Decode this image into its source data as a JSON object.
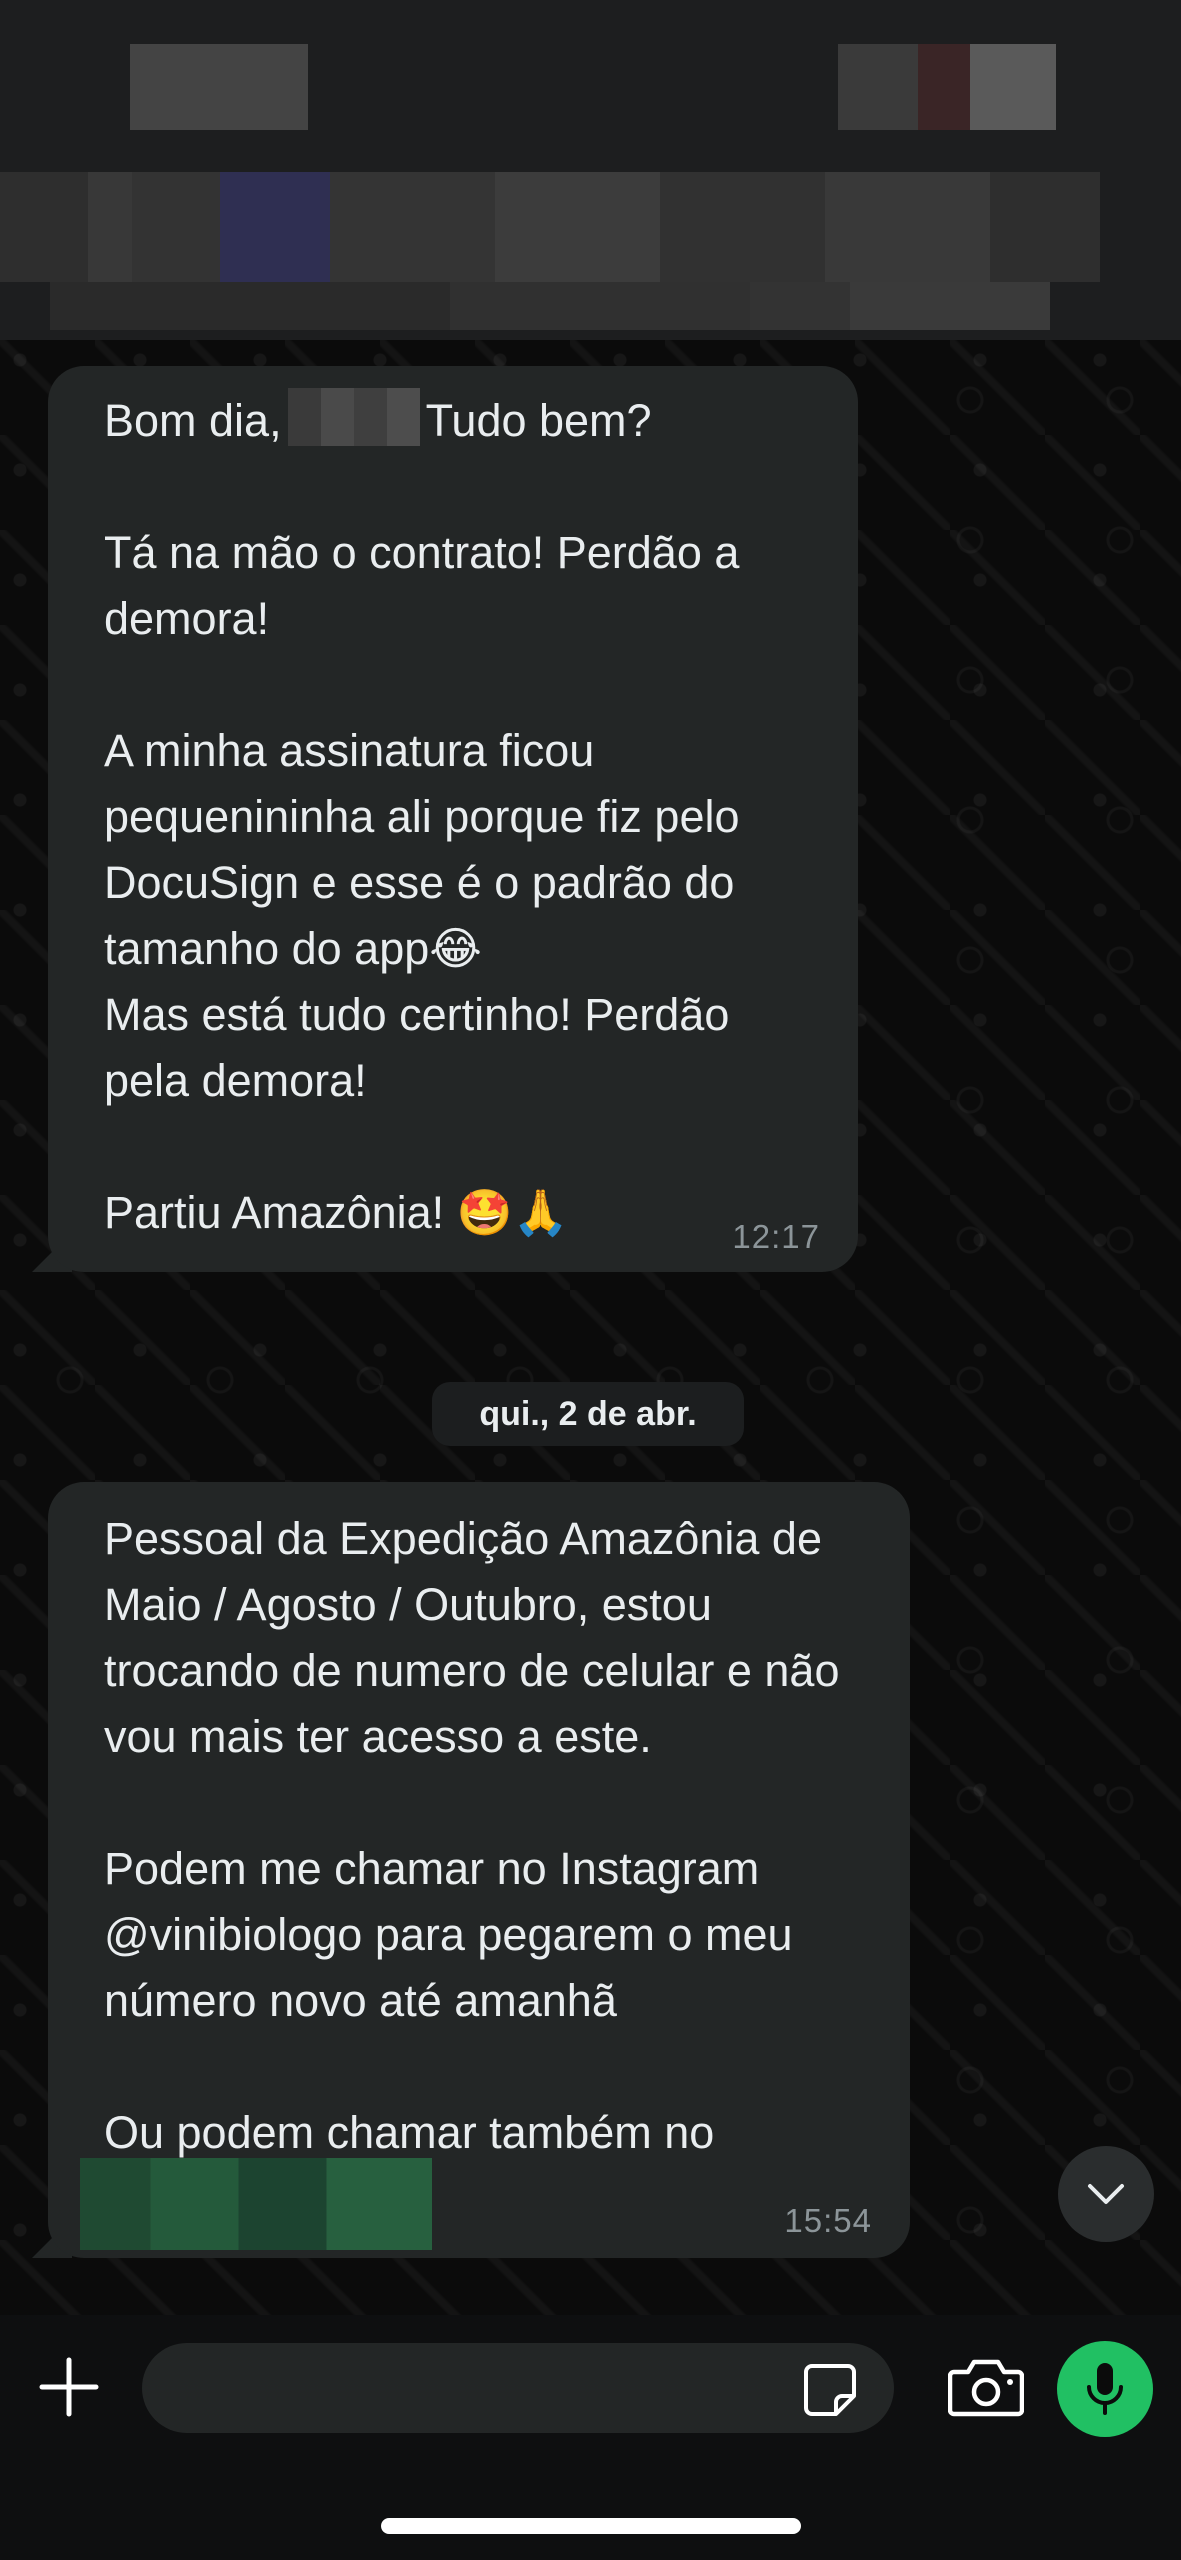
{
  "messages": [
    {
      "greeting_prefix": "Bom dia,",
      "greeting_suffix": "Tudo bem?",
      "body": "Tá na mão o contrato! Perdão a demora!\n\nA minha assinatura ficou pequenininha ali porque fiz pelo DocuSign e esse é o padrão do tamanho do app😂\nMas está tudo certinho! Perdão pela demora!\n\nPartiu Amazônia! 🤩🙏",
      "time": "12:17"
    },
    {
      "body": "Pessoal da Expedição Amazônia de Maio / Agosto / Outubro, estou trocando de numero de celular e não vou mais ter acesso a este.\n\nPodem me chamar no Instagram @vinibiologo para pegarem o meu número novo até amanhã\n\nOu podem chamar também no",
      "time": "15:54"
    }
  ],
  "date_separator": "qui., 2 de abr.",
  "icons": {
    "plus": "plus-icon",
    "sticker": "sticker-icon",
    "camera": "camera-icon",
    "mic": "microphone-icon",
    "scroll": "chevron-down-icon"
  },
  "colors": {
    "bubble": "#232626",
    "mic_button": "#21c063",
    "redaction_green": "#245a3b"
  }
}
